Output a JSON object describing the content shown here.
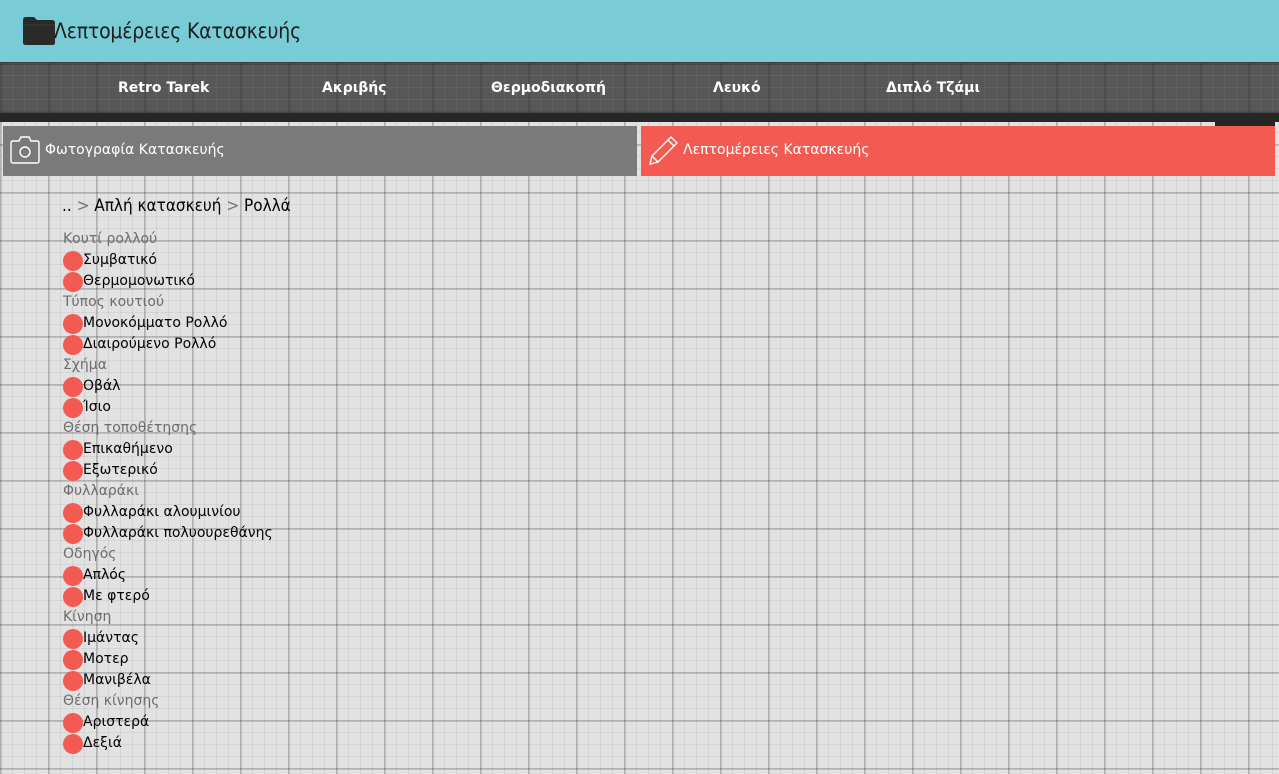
{
  "header": {
    "title": "Λεπτομέρειες Κατασκευής",
    "icon": "folder-icon",
    "background": "#79ccd6"
  },
  "nav": {
    "items": [
      {
        "label": "Retro Tarek"
      },
      {
        "label": "Ακριβής"
      },
      {
        "label": "Θερμοδιακοπή"
      },
      {
        "label": "Λευκό"
      },
      {
        "label": "Διπλό Τζάμι"
      }
    ]
  },
  "scroll_top": {
    "icon": "chevron-up-icon"
  },
  "tabs": {
    "photo": {
      "label": "Φωτογραφία Κατασκευής",
      "icon": "camera-icon",
      "color": "#7a7a7a"
    },
    "details": {
      "label": "Λεπτομέρειες Κατασκευής",
      "icon": "pencil-icon",
      "color": "#f35b52"
    }
  },
  "breadcrumb": {
    "root": "..",
    "separator": ">",
    "level1": "Απλή κατασκευή",
    "level2": "Ρολλά"
  },
  "option_groups": [
    {
      "label": "Κουτί ρολλού",
      "options": [
        "Συμβατικό",
        "Θερμομονωτικό"
      ]
    },
    {
      "label": "Τύπος κουτιού",
      "options": [
        "Μονοκόμματο Ρολλό",
        "Διαιρούμενο Ρολλό"
      ]
    },
    {
      "label": "Σχήμα",
      "options": [
        "Οβάλ",
        "Ίσιο"
      ]
    },
    {
      "label": "Θέση τοποθέτησης",
      "options": [
        "Επικαθήμενο",
        "Εξωτερικό"
      ]
    },
    {
      "label": "Φυλλαράκι",
      "options": [
        "Φυλλαράκι αλουμινίου",
        "Φυλλαράκι πολυουρεθάνης"
      ]
    },
    {
      "label": "Οδηγός",
      "options": [
        "Απλός",
        "Με φτερό"
      ]
    },
    {
      "label": "Κίνηση",
      "options": [
        "Ιμάντας",
        "Μοτερ",
        "Μανιβέλα"
      ]
    },
    {
      "label": "Θέση κίνησης",
      "options": [
        "Αριστερά",
        "Δεξιά"
      ]
    }
  ],
  "colors": {
    "accent": "#f35b52",
    "dark": "#262626",
    "nav": "#575757"
  }
}
